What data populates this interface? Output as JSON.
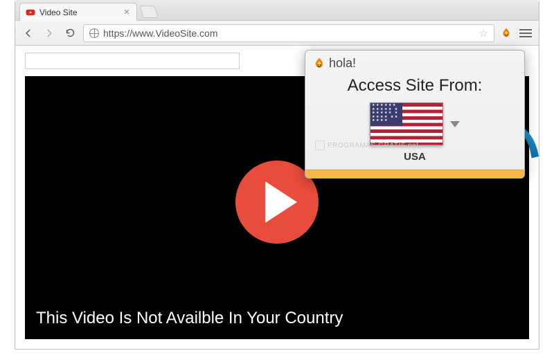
{
  "tab": {
    "title": "Video Site"
  },
  "address": {
    "url": "https://www.VideoSite.com"
  },
  "page": {
    "search_placeholder": "",
    "video_message": "This Video Is Not Availble In Your Country"
  },
  "popup": {
    "brand": "hola!",
    "title": "Access Site From:",
    "selected_country": "USA"
  },
  "watermark": {
    "text": "PROGRAMAS-GRATIS.net"
  }
}
